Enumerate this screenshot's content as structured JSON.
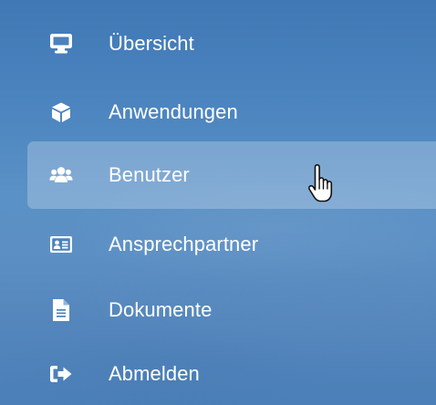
{
  "sidebar": {
    "items": [
      {
        "label": "Übersicht",
        "icon": "monitor-icon"
      },
      {
        "label": "Anwendungen",
        "icon": "cube-icon"
      },
      {
        "label": "Benutzer",
        "icon": "users-icon",
        "active": true
      },
      {
        "label": "Ansprechpartner",
        "icon": "address-card-icon"
      },
      {
        "label": "Dokumente",
        "icon": "file-icon"
      },
      {
        "label": "Abmelden",
        "icon": "sign-out-icon"
      }
    ]
  },
  "colors": {
    "text": "#ffffff",
    "background": "#4f88c0",
    "active_highlight": "rgba(255,255,255,0.24)"
  },
  "cursor": "hand-pointer-icon"
}
